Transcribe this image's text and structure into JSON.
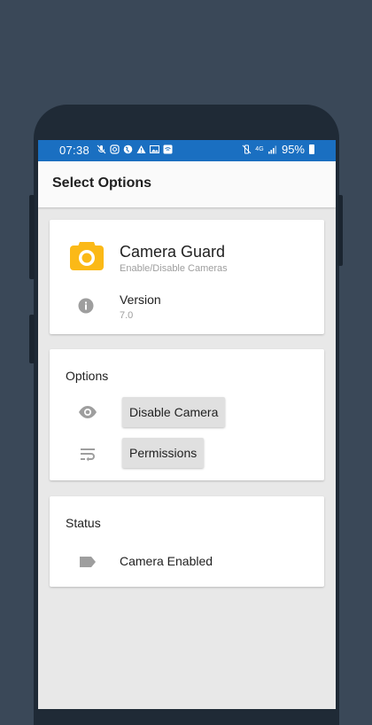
{
  "status_bar": {
    "time": "07:38",
    "network": "4G",
    "battery_percent": "95%"
  },
  "app_bar": {
    "title": "Select Options"
  },
  "app_card": {
    "app_name": "Camera Guard",
    "app_subtitle": "Enable/Disable Cameras",
    "version_label": "Version",
    "version_value": "7.0",
    "icon_color": "#fbb917"
  },
  "options_card": {
    "title": "Options",
    "disable_camera_label": "Disable Camera",
    "permissions_label": "Permissions"
  },
  "status_card": {
    "title": "Status",
    "status_text": "Camera Enabled"
  },
  "colors": {
    "status_bar": "#1a6fc1",
    "background": "#3a4858",
    "screen_bg": "#e8e8e8"
  }
}
